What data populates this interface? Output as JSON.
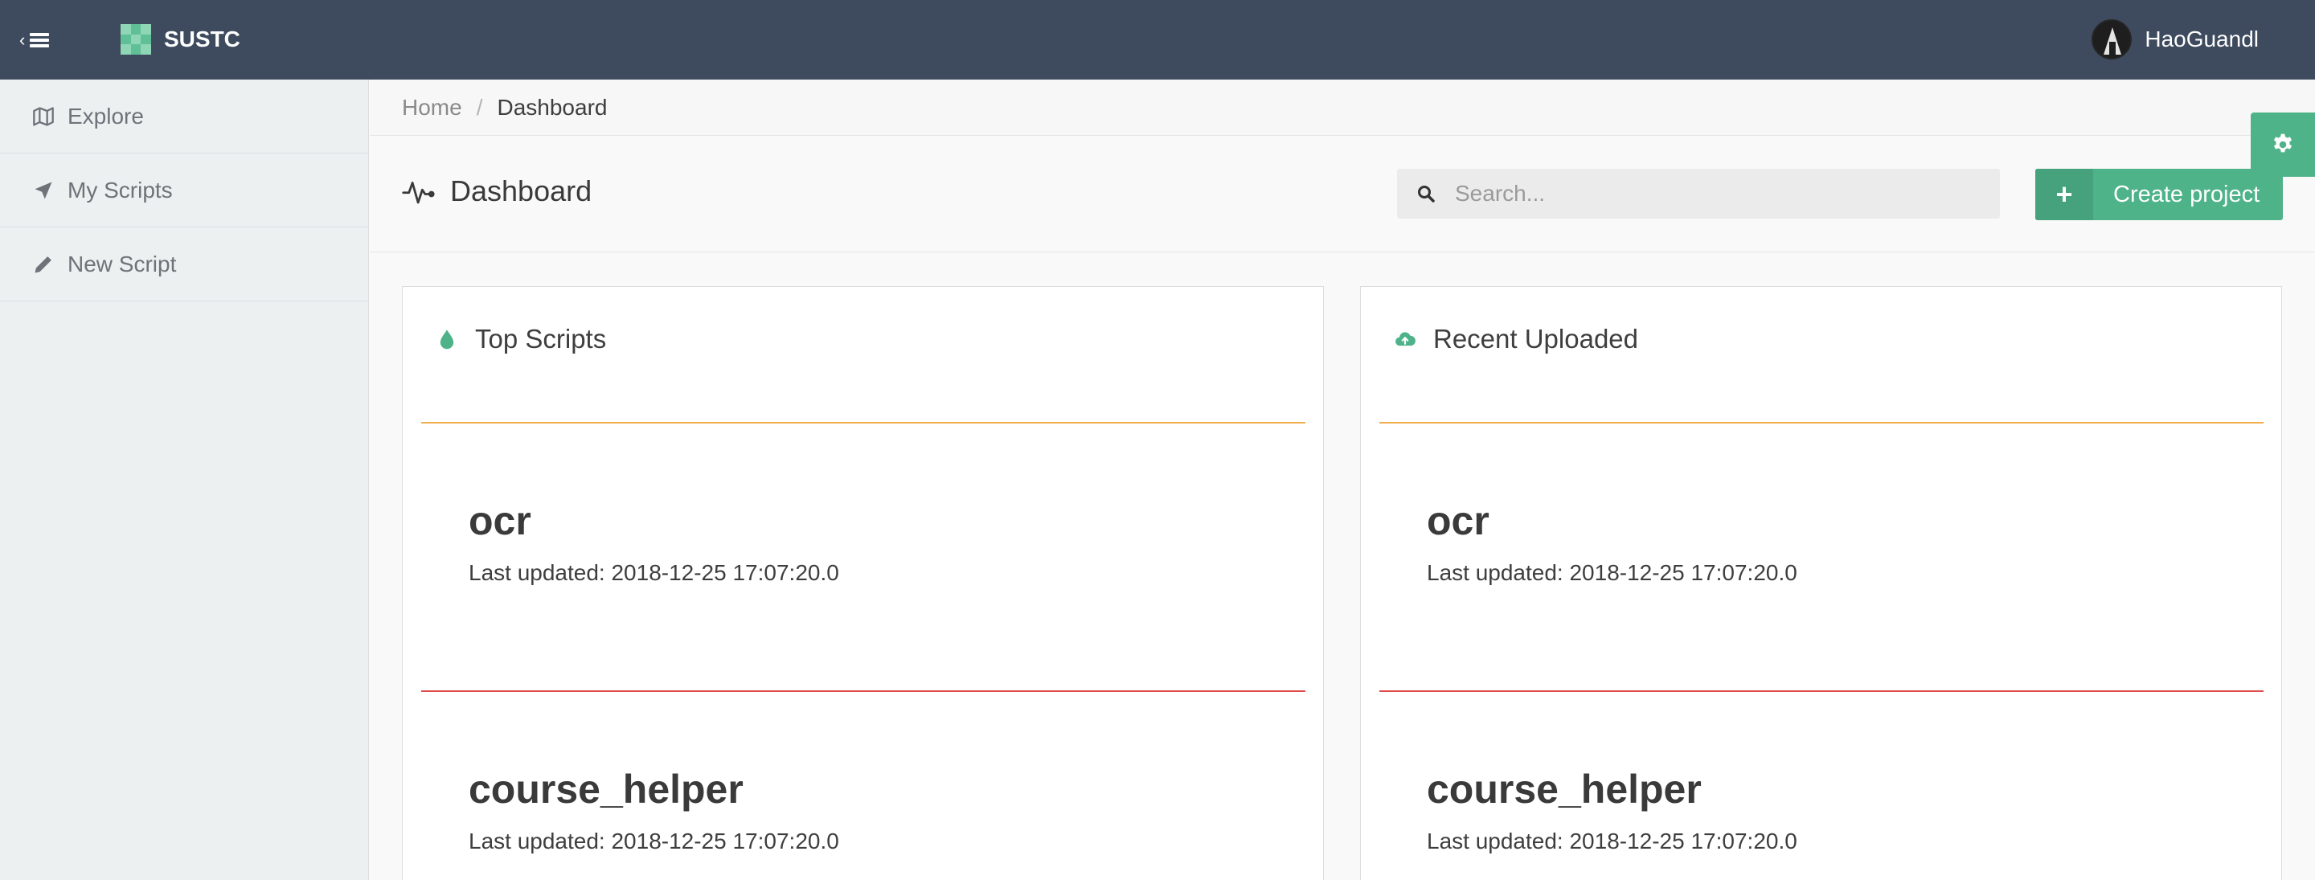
{
  "brand": {
    "name": "SUSTC"
  },
  "user": {
    "name": "HaoGuandl"
  },
  "sidebar": {
    "items": [
      {
        "label": "Explore",
        "icon": "map-icon"
      },
      {
        "label": "My Scripts",
        "icon": "location-arrow-icon"
      },
      {
        "label": "New Script",
        "icon": "pencil-icon"
      }
    ]
  },
  "breadcrumb": {
    "home": "Home",
    "separator": "/",
    "current": "Dashboard"
  },
  "page": {
    "title": "Dashboard",
    "icon": "pulse-icon"
  },
  "search": {
    "placeholder": "Search..."
  },
  "create_button": {
    "label": "Create project",
    "icon": "+"
  },
  "colors": {
    "topbar": "#3e4b5e",
    "accent": "#4fb38a",
    "divider_top": "#f0ad4e",
    "divider_bottom": "#e04b4b"
  },
  "panels": [
    {
      "title": "Top Scripts",
      "icon": "drop-icon",
      "items": [
        {
          "name": "ocr",
          "updated": "Last updated: 2018-12-25 17:07:20.0"
        },
        {
          "name": "course_helper",
          "updated": "Last updated: 2018-12-25 17:07:20.0"
        }
      ]
    },
    {
      "title": "Recent Uploaded",
      "icon": "cloud-upload-icon",
      "items": [
        {
          "name": "ocr",
          "updated": "Last updated: 2018-12-25 17:07:20.0"
        },
        {
          "name": "course_helper",
          "updated": "Last updated: 2018-12-25 17:07:20.0"
        }
      ]
    }
  ]
}
